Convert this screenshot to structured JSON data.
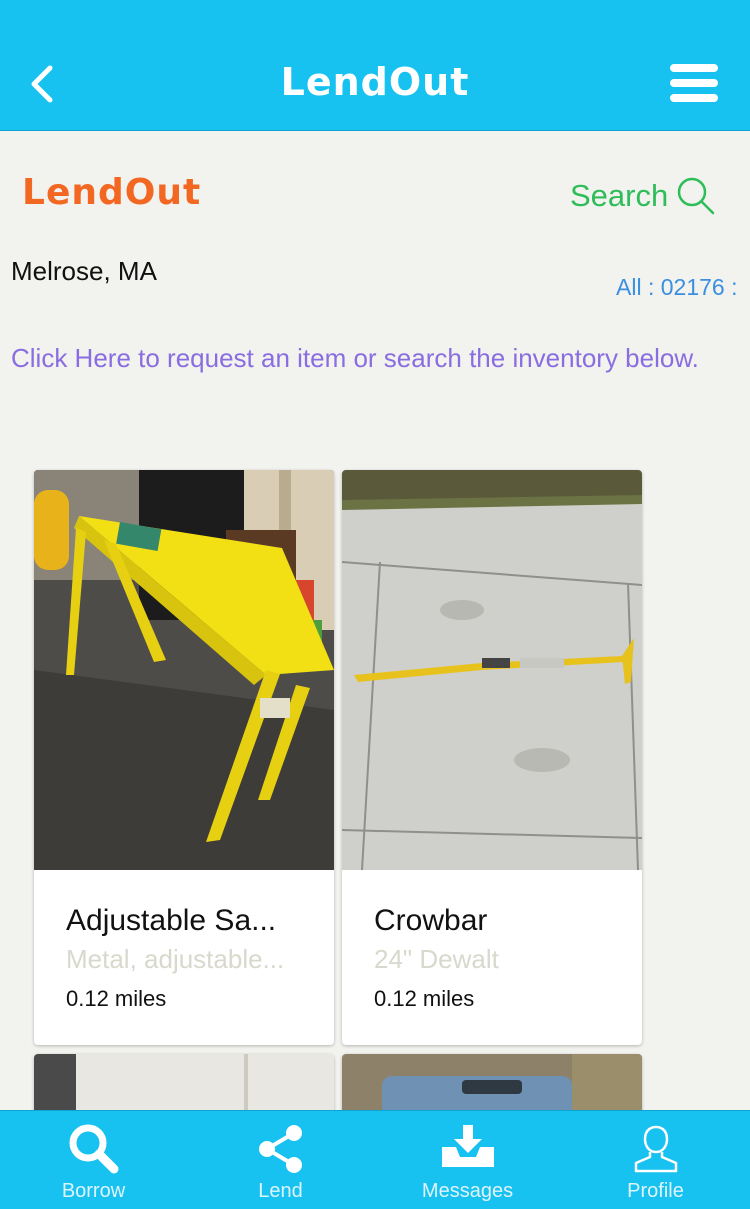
{
  "header": {
    "title": "LendOut",
    "back_icon": "chevron-left-icon",
    "menu_icon": "hamburger-menu-icon",
    "color": "#17c1f0"
  },
  "brand": {
    "logo_text": "LendOut",
    "color": "#f26722"
  },
  "search": {
    "label": "Search",
    "icon": "magnifier-icon",
    "color": "#2ebd59"
  },
  "location": {
    "text": "Melrose, MA"
  },
  "zip_filter": {
    "text": "All : 02176 :"
  },
  "request_link": {
    "text": "Click Here to request an item or search the inventory below."
  },
  "items": [
    {
      "name": "Adjustable Sa...",
      "description": "Metal, adjustable...",
      "distance": "0.12 miles",
      "photo": "yellow-sawhorse-photo"
    },
    {
      "name": "Crowbar",
      "description": "24\" Dewalt",
      "distance": "0.12 miles",
      "photo": "crowbar-on-sidewalk-photo"
    }
  ],
  "tabs": [
    {
      "label": "Borrow",
      "icon": "magnifier-icon"
    },
    {
      "label": "Lend",
      "icon": "share-icon"
    },
    {
      "label": "Messages",
      "icon": "inbox-download-icon"
    },
    {
      "label": "Profile",
      "icon": "person-icon"
    }
  ]
}
